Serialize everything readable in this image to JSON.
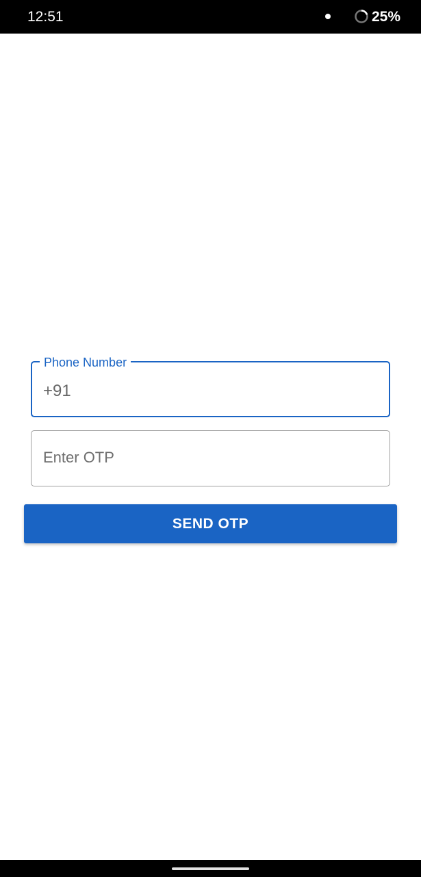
{
  "status_bar": {
    "time": "12:51",
    "battery_percent": "25%",
    "icons": [
      "notification-dot-icon",
      "battery-icon"
    ]
  },
  "form": {
    "phone_field": {
      "label": "Phone Number",
      "value": "+91"
    },
    "otp_field": {
      "placeholder": "Enter OTP"
    },
    "send_button_label": "SEND OTP"
  },
  "colors": {
    "accent": "#1a64c4",
    "status_bar": "#000000",
    "background": "#ffffff"
  }
}
